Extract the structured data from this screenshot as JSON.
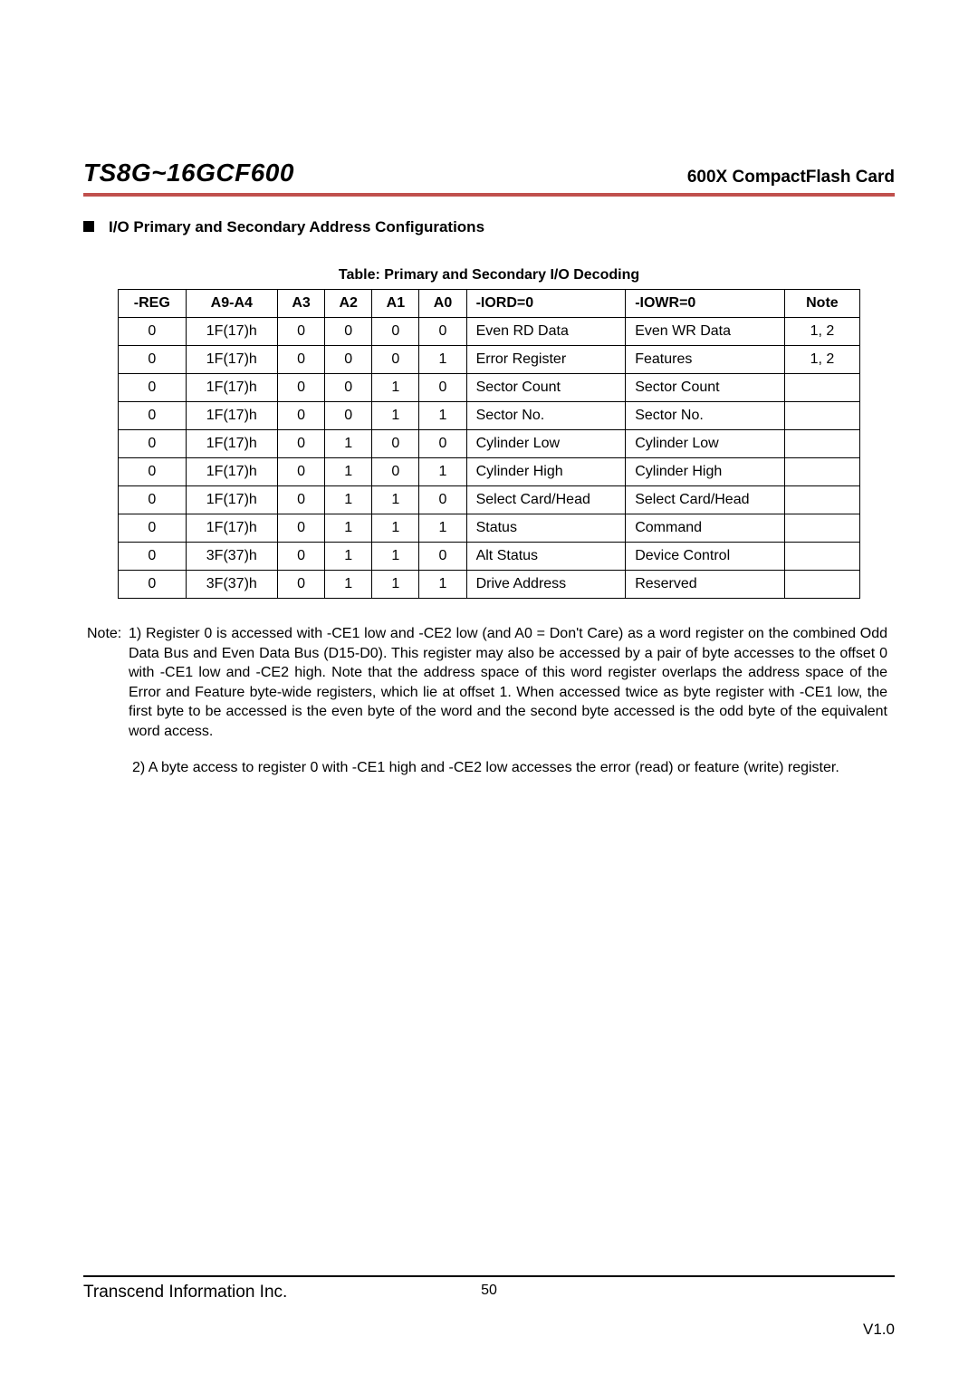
{
  "header": {
    "title": "TS8G~16GCF600",
    "subtitle": "600X CompactFlash Card"
  },
  "section": {
    "heading": "I/O Primary and Secondary Address Configurations"
  },
  "table": {
    "caption": "Table: Primary and Secondary I/O Decoding",
    "headers": [
      "-REG",
      "A9-A4",
      "A3",
      "A2",
      "A1",
      "A0",
      "-IORD=0",
      "-IOWR=0",
      "Note"
    ],
    "rows": [
      {
        "reg": "0",
        "a9a4": "1F(17)h",
        "a3": "0",
        "a2": "0",
        "a1": "0",
        "a0": "0",
        "iord": "Even RD Data",
        "iowr": "Even WR Data",
        "note": "1, 2"
      },
      {
        "reg": "0",
        "a9a4": "1F(17)h",
        "a3": "0",
        "a2": "0",
        "a1": "0",
        "a0": "1",
        "iord": "Error Register",
        "iowr": "Features",
        "note": "1, 2"
      },
      {
        "reg": "0",
        "a9a4": "1F(17)h",
        "a3": "0",
        "a2": "0",
        "a1": "1",
        "a0": "0",
        "iord": "Sector Count",
        "iowr": "Sector Count",
        "note": ""
      },
      {
        "reg": "0",
        "a9a4": "1F(17)h",
        "a3": "0",
        "a2": "0",
        "a1": "1",
        "a0": "1",
        "iord": "Sector No.",
        "iowr": "Sector No.",
        "note": ""
      },
      {
        "reg": "0",
        "a9a4": "1F(17)h",
        "a3": "0",
        "a2": "1",
        "a1": "0",
        "a0": "0",
        "iord": "Cylinder Low",
        "iowr": "Cylinder Low",
        "note": ""
      },
      {
        "reg": "0",
        "a9a4": "1F(17)h",
        "a3": "0",
        "a2": "1",
        "a1": "0",
        "a0": "1",
        "iord": "Cylinder High",
        "iowr": "Cylinder High",
        "note": ""
      },
      {
        "reg": "0",
        "a9a4": "1F(17)h",
        "a3": "0",
        "a2": "1",
        "a1": "1",
        "a0": "0",
        "iord": "Select Card/Head",
        "iowr": "Select Card/Head",
        "note": ""
      },
      {
        "reg": "0",
        "a9a4": "1F(17)h",
        "a3": "0",
        "a2": "1",
        "a1": "1",
        "a0": "1",
        "iord": "Status",
        "iowr": "Command",
        "note": ""
      },
      {
        "reg": "0",
        "a9a4": "3F(37)h",
        "a3": "0",
        "a2": "1",
        "a1": "1",
        "a0": "0",
        "iord": "Alt Status",
        "iowr": "Device Control",
        "note": ""
      },
      {
        "reg": "0",
        "a9a4": "3F(37)h",
        "a3": "0",
        "a2": "1",
        "a1": "1",
        "a0": "1",
        "iord": "Drive Address",
        "iowr": "Reserved",
        "note": ""
      }
    ]
  },
  "notes": {
    "label": "Note:",
    "text1": "1) Register 0 is accessed with -CE1 low and -CE2 low (and A0 = Don't Care) as a word register on the combined Odd Data Bus and Even Data Bus (D15-D0). This register may also be accessed by a pair of byte accesses to the offset 0 with -CE1 low and -CE2 high. Note that the address space of this word register overlaps the address space of the Error and Feature byte-wide registers, which lie at offset 1. When accessed twice as byte register with -CE1 low, the first byte to be accessed is the even byte of the word and the second byte accessed is the odd byte of the equivalent word access.",
    "text2": "2) A byte access to register 0 with -CE1 high and -CE2 low accesses the error (read) or feature (write) register."
  },
  "footer": {
    "company": "Transcend Information Inc.",
    "page": "50",
    "version": "V1.0"
  }
}
